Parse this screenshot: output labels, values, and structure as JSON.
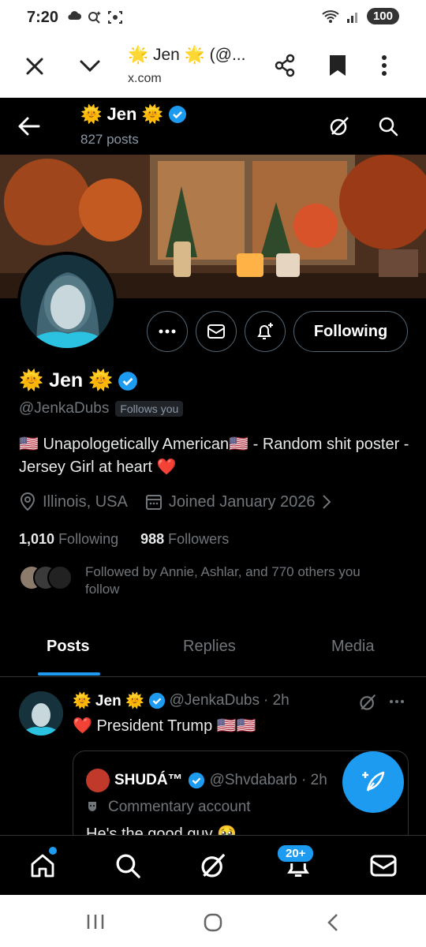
{
  "status_bar": {
    "time": "7:20",
    "battery": "100"
  },
  "browser": {
    "tab_title": "🌟 Jen 🌟 (@...",
    "url": "x.com"
  },
  "header": {
    "name": "🌞 Jen 🌞",
    "posts_count": "827 posts"
  },
  "profile": {
    "name": "🌞 Jen 🌞",
    "handle": "@JenkaDubs",
    "follows_you": "Follows you",
    "bio": "🇺🇸 Unapologetically American🇺🇸 - Random shit poster - Jersey Girl at heart ❤️",
    "location": "Illinois, USA",
    "joined": "Joined January 2026",
    "following_count": "1,010",
    "following_label": "Following",
    "followers_count": "988",
    "followers_label": "Followers",
    "followed_by": "Followed by Annie, Ashlar, and 770 others you follow",
    "follow_button": "Following"
  },
  "tabs": [
    {
      "label": "Posts"
    },
    {
      "label": "Replies"
    },
    {
      "label": "Media"
    }
  ],
  "tweet": {
    "name": "🌞 Jen 🌞",
    "handle": "@JenkaDubs",
    "time": "· 2h",
    "text": "❤️ President Trump 🇺🇸🇺🇸",
    "quote": {
      "name": "SHUDÁ™",
      "handle": "@Shvdabarb · 2h",
      "label": "Commentary account",
      "text": "He's the good guy 🥹"
    }
  },
  "bottom_nav": {
    "notifications_badge": "20+"
  },
  "colors": {
    "accent": "#1d9bf0",
    "background": "#000000",
    "muted": "#71767b"
  }
}
